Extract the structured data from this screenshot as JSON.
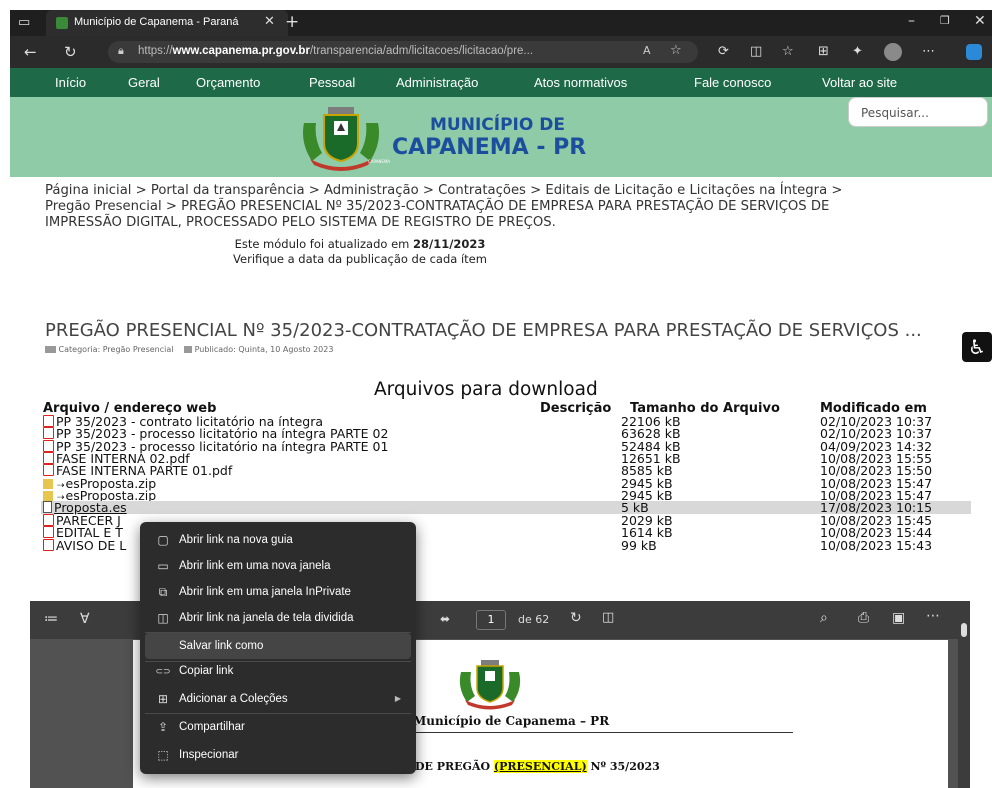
{
  "browser": {
    "tab_title": "Município de Capanema - Paraná",
    "url_prefix": "https://",
    "url_domain": "www.capanema.pr.gov.br",
    "url_path": "/transparencia/adm/licitacoes/licitacao/pre...",
    "icons": [
      "window-icon",
      "tab-favicon",
      "tab-close-icon",
      "new-tab-icon",
      "minimize-icon",
      "restore-icon",
      "close-icon",
      "back-icon",
      "refresh-icon",
      "lock-icon",
      "read-aloud-icon",
      "favorite-icon",
      "extensions-icon",
      "split-screen-icon",
      "favorites-icon",
      "collections-icon",
      "copilot-icon",
      "profile-icon",
      "more-icon"
    ]
  },
  "nav": {
    "items": [
      "Início",
      "Geral",
      "Orçamento",
      "Pessoal",
      "Administração",
      "Atos normativos",
      "Fale conosco",
      "Voltar ao site"
    ]
  },
  "header": {
    "search_placeholder": "Pesquisar...",
    "title_line1": "MUNICÍPIO DE",
    "title_line2": "CAPANEMA - PR",
    "crest_text": "CAPANEMA",
    "colors": {
      "nav_bg": "#1e6a48",
      "header_bg": "#8fcba6",
      "title": "#1c4e9e"
    }
  },
  "breadcrumb": {
    "line1": "Página inicial > Portal da transparência > Administração > Contratações > Editais de Licitação e Licitações na Íntegra >",
    "line2": "Pregão Presencial > PREGÃO PRESENCIAL Nº 35/2023-CONTRATAÇÃO DE EMPRESA PARA PRESTAÇÃO DE SERVIÇOS DE",
    "line3": "IMPRESSÃO DIGITAL, PROCESSADO PELO SISTEMA DE REGISTRO DE PREÇOS."
  },
  "update": {
    "text": "Este módulo foi atualizado em",
    "date": "28/11/2023",
    "note": "Verifique a data da publicação de cada ítem"
  },
  "article": {
    "title": "PREGÃO PRESENCIAL Nº 35/2023-CONTRATAÇÃO DE EMPRESA PARA PRESTAÇÃO DE SERVIÇOS ...",
    "category": "Categoria: Pregão Presencial",
    "published": "Publicado: Quinta, 10 Agosto 2023"
  },
  "downloads": {
    "heading": "Arquivos para download",
    "columns": [
      "Arquivo / endereço web",
      "Descrição",
      "Tamanho do Arquivo",
      "Modificado em"
    ],
    "rows": [
      {
        "icon": "pdf",
        "name": "PP 35/2023 - contrato licitatório na íntegra",
        "size": "22106 kB",
        "modified": "02/10/2023 10:37"
      },
      {
        "icon": "pdf",
        "name": "PP 35/2023 - processo licitatório na íntegra PARTE 02",
        "size": "63628 kB",
        "modified": "02/10/2023 10:37"
      },
      {
        "icon": "pdf",
        "name": "PP 35/2023 - processo licitatório na íntegra PARTE 01",
        "size": "52484 kB",
        "modified": "04/09/2023 14:32"
      },
      {
        "icon": "pdf",
        "name": "FASE INTERNA 02.pdf",
        "size": "12651 kB",
        "modified": "10/08/2023 15:55"
      },
      {
        "icon": "pdf",
        "name": "FASE INTERNA PARTE 01.pdf",
        "size": "8585 kB",
        "modified": "10/08/2023 15:50"
      },
      {
        "icon": "zip",
        "name": "esProposta.zip",
        "size": "2945 kB",
        "modified": "10/08/2023 15:47"
      },
      {
        "icon": "zip",
        "name": "esProposta.zip",
        "size": "2945 kB",
        "modified": "10/08/2023 15:47"
      },
      {
        "icon": "file",
        "name": "Proposta.es",
        "size": "5 kB",
        "modified": "17/08/2023 10:15"
      },
      {
        "icon": "pdf",
        "name": "PARECER J",
        "size": "2029 kB",
        "modified": "10/08/2023 15:45"
      },
      {
        "icon": "pdf",
        "name": "EDITAL E T",
        "size": "1614 kB",
        "modified": "10/08/2023 15:44"
      },
      {
        "icon": "pdf",
        "name": "AVISO DE L",
        "size": "99 kB",
        "modified": "10/08/2023 15:43"
      }
    ]
  },
  "pdf_viewer": {
    "page_current": "1",
    "page_total": "de 62",
    "doc_title": "Município de Capanema – PR",
    "doc_line_prefix": "DE PREGÃO ",
    "doc_line_highlight": "(PRESENCIAL)",
    "doc_line_suffix": " Nº 35/2023",
    "highlight_color": "#ffff00"
  },
  "context_menu": {
    "items": [
      {
        "label": "Abrir link na nova guia",
        "icon": "new-tab-icon"
      },
      {
        "label": "Abrir link em uma nova janela",
        "icon": "new-window-icon"
      },
      {
        "label": "Abrir link em uma janela InPrivate",
        "icon": "inprivate-icon"
      },
      {
        "label": "Abrir link na janela de tela dividida",
        "icon": "split-window-icon"
      },
      {
        "label": "Salvar link como",
        "icon": ""
      },
      {
        "label": "Copiar link",
        "icon": "link-icon"
      },
      {
        "label": "Adicionar a Coleções",
        "icon": "collections-icon"
      },
      {
        "label": "Compartilhar",
        "icon": "share-icon"
      },
      {
        "label": "Inspecionar",
        "icon": "inspect-icon"
      }
    ],
    "highlighted": "Salvar link como"
  }
}
